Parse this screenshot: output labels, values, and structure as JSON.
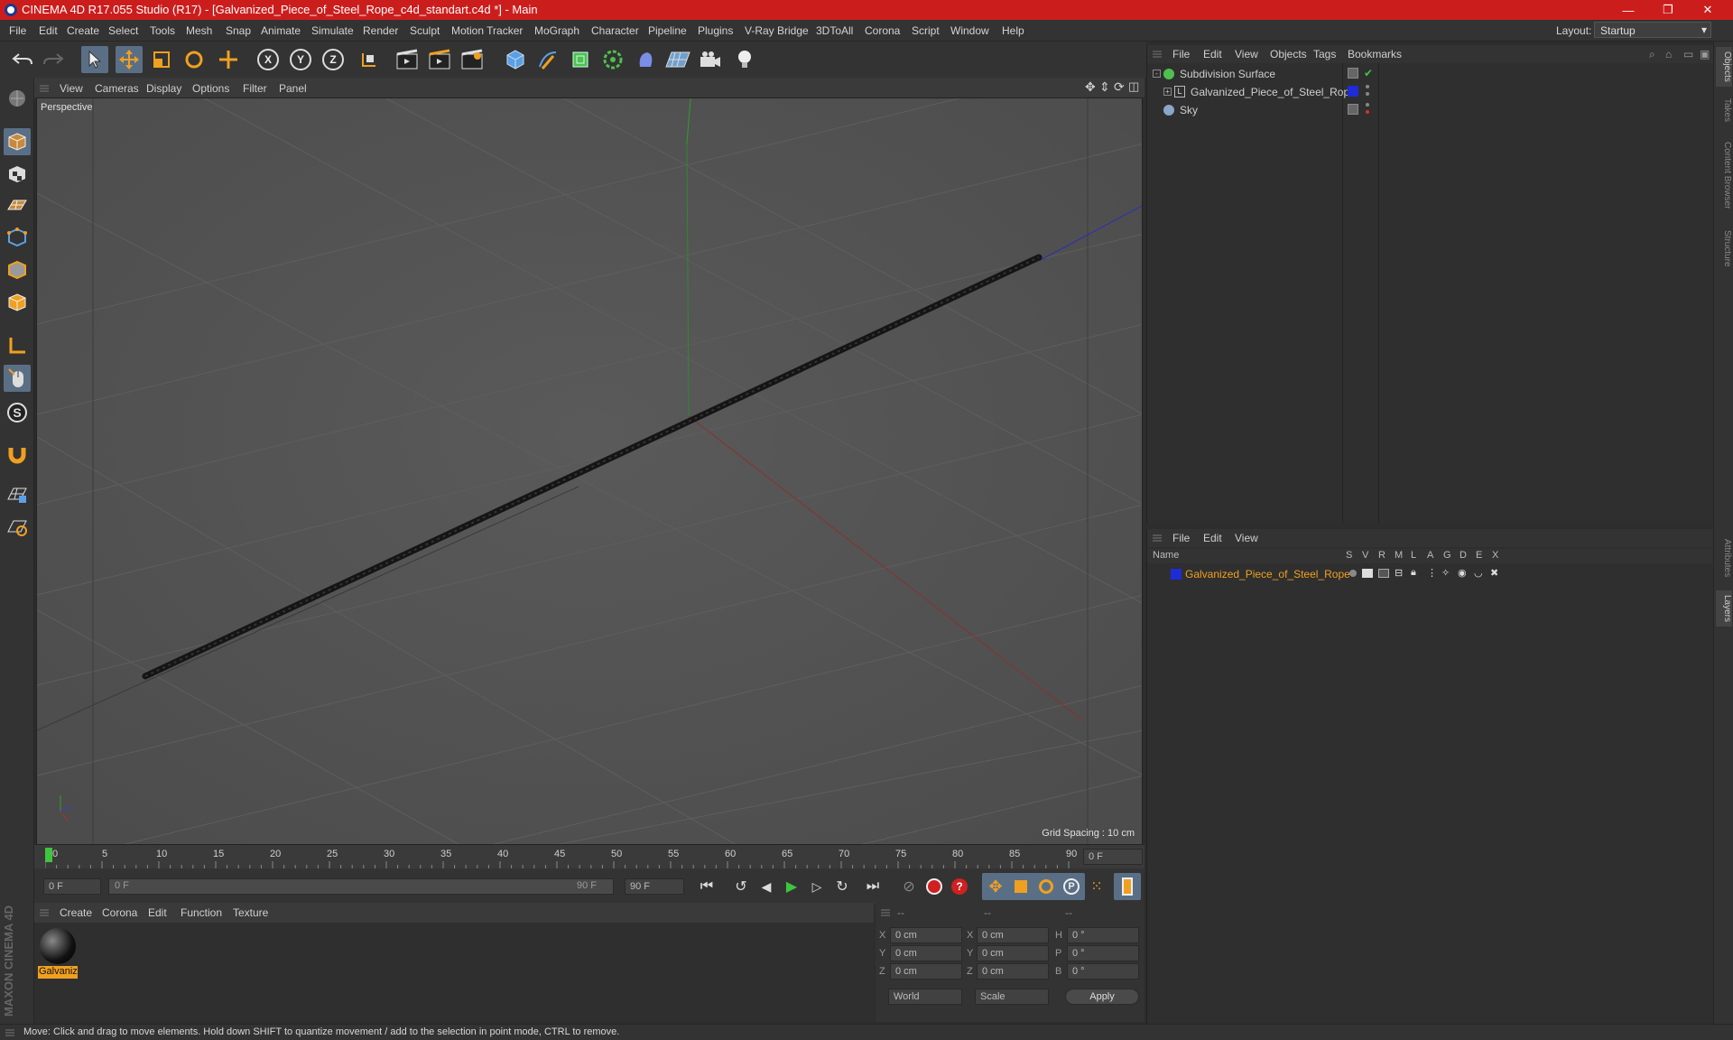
{
  "window": {
    "title": "CINEMA 4D R17.055 Studio (R17) - [Galvanized_Piece_of_Steel_Rope_c4d_standart.c4d *] - Main",
    "controls": [
      "—",
      "❐",
      "✕"
    ]
  },
  "menubar": {
    "items": [
      "File",
      "Edit",
      "Create",
      "Select",
      "Tools",
      "Mesh",
      "Snap",
      "Animate",
      "Simulate",
      "Render",
      "Sculpt",
      "Motion Tracker",
      "MoGraph",
      "Character",
      "Pipeline",
      "Plugins",
      "V-Ray Bridge",
      "3DToAll",
      "Corona",
      "Script",
      "Window",
      "Help"
    ],
    "layout_label": "Layout:",
    "layout_value": "Startup"
  },
  "toolbar": {
    "axis_x": "X",
    "axis_y": "Y",
    "axis_z": "Z"
  },
  "viewport": {
    "menu": [
      "View",
      "Cameras",
      "Display",
      "Options",
      "Filter",
      "Panel"
    ],
    "label": "Perspective",
    "grid_spacing": "Grid Spacing : 10 cm"
  },
  "timeline": {
    "ticks": [
      "0",
      "5",
      "10",
      "15",
      "20",
      "25",
      "30",
      "35",
      "40",
      "45",
      "50",
      "55",
      "60",
      "65",
      "70",
      "75",
      "80",
      "85",
      "90"
    ],
    "current_frame": "0 F",
    "start_field": "0 F",
    "range_start": "0 F",
    "range_end": "90 F",
    "end_field": "90 F"
  },
  "material_manager": {
    "menu": [
      "Create",
      "Corona",
      "Edit",
      "Function",
      "Texture"
    ],
    "materials": [
      {
        "name": "Galvaniz"
      }
    ]
  },
  "coordinates": {
    "headers": [
      "--",
      "--",
      "--"
    ],
    "rows": [
      {
        "a": "X",
        "av": "0 cm",
        "b": "X",
        "bv": "0 cm",
        "c": "H",
        "cv": "0 °"
      },
      {
        "a": "Y",
        "av": "0 cm",
        "b": "Y",
        "bv": "0 cm",
        "c": "P",
        "cv": "0 °"
      },
      {
        "a": "Z",
        "av": "0 cm",
        "b": "Z",
        "bv": "0 cm",
        "c": "B",
        "cv": "0 °"
      }
    ],
    "mode_world": "World",
    "mode_scale": "Scale",
    "apply": "Apply"
  },
  "object_manager": {
    "menu": [
      "File",
      "Edit",
      "View",
      "Objects",
      "Tags",
      "Bookmarks"
    ],
    "objects": [
      {
        "name": "Subdivision Surface",
        "color": "#4fbf4f"
      },
      {
        "name": "Galvanized_Piece_of_Steel_Rope",
        "color": "#1e2bd6"
      },
      {
        "name": "Sky",
        "color": "#8aa6c8"
      }
    ]
  },
  "layer_manager": {
    "menu": [
      "File",
      "Edit",
      "View"
    ],
    "columns": [
      "Name",
      "S",
      "V",
      "R",
      "M",
      "L",
      "A",
      "G",
      "D",
      "E",
      "X"
    ],
    "layers": [
      {
        "name": "Galvanized_Piece_of_Steel_Rope",
        "color": "#1e2bd6"
      }
    ]
  },
  "right_tabs": [
    "Objects",
    "Takes",
    "Content Browser",
    "Structure",
    "Attributes",
    "Layers"
  ],
  "status": {
    "text": "Move: Click and drag to move elements. Hold down SHIFT to quantize movement / add to the selection in point mode, CTRL to remove."
  },
  "brand": {
    "text": "MAXON CINEMA 4D"
  },
  "colors": {
    "accent": "#5a6f86",
    "title_red": "#cc1d1d",
    "orange": "#f0a020"
  }
}
